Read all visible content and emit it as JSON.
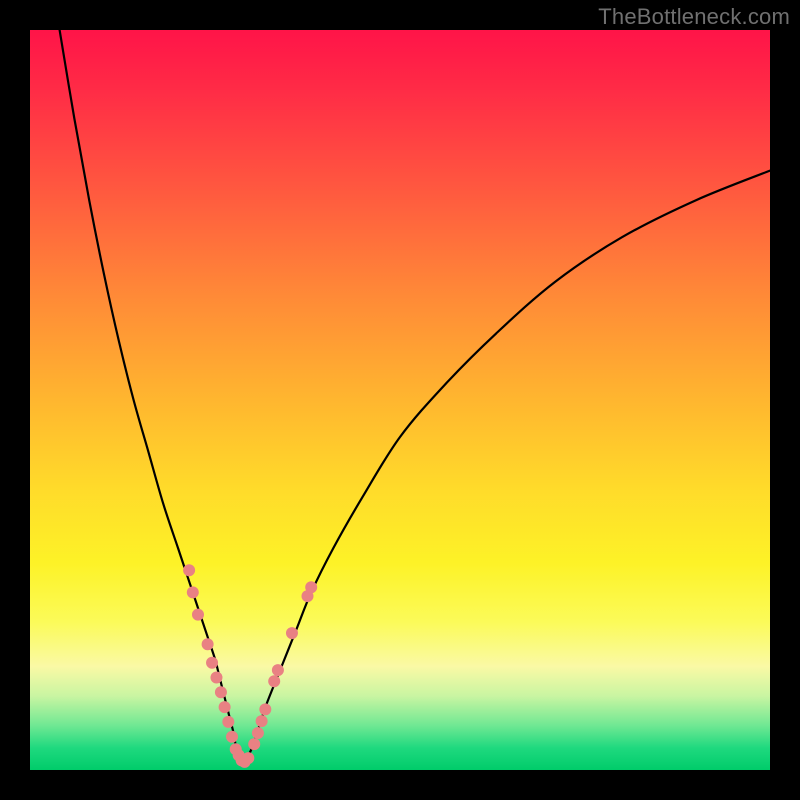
{
  "watermark": "TheBottleneck.com",
  "colors": {
    "frame": "#000000",
    "curve": "#000000",
    "marker_fill": "#e98183",
    "marker_stroke": "#e98183",
    "gradient_stops": [
      "#ff1448",
      "#ff5a3f",
      "#ffb62f",
      "#fdf227",
      "#00cc6a"
    ]
  },
  "chart_data": {
    "type": "line",
    "title": "",
    "xlabel": "",
    "ylabel": "",
    "xlim": [
      0,
      100
    ],
    "ylim": [
      0,
      100
    ],
    "grid": false,
    "legend": false,
    "annotations": [
      {
        "text": "TheBottleneck.com",
        "position": "top-right"
      }
    ],
    "series": [
      {
        "name": "left-branch",
        "x": [
          4,
          6,
          8,
          10,
          12,
          14,
          16,
          18,
          20,
          21,
          22,
          23,
          24,
          25,
          25.5,
          26,
          26.5,
          27,
          27.5,
          28
        ],
        "y": [
          100,
          88,
          77,
          67,
          58,
          50,
          43,
          36,
          30,
          27,
          24,
          21,
          18,
          15,
          13,
          11,
          9,
          7,
          5,
          2
        ]
      },
      {
        "name": "right-branch",
        "x": [
          29,
          30,
          31,
          32,
          34,
          36,
          38,
          41,
          45,
          50,
          56,
          63,
          71,
          80,
          90,
          100
        ],
        "y": [
          1,
          3,
          6,
          9,
          14,
          19,
          24,
          30,
          37,
          45,
          52,
          59,
          66,
          72,
          77,
          81
        ]
      }
    ],
    "markers": [
      {
        "x": 21.5,
        "y": 27
      },
      {
        "x": 22.0,
        "y": 24
      },
      {
        "x": 22.7,
        "y": 21
      },
      {
        "x": 24.0,
        "y": 17
      },
      {
        "x": 24.6,
        "y": 14.5
      },
      {
        "x": 25.2,
        "y": 12.5
      },
      {
        "x": 25.8,
        "y": 10.5
      },
      {
        "x": 26.3,
        "y": 8.5
      },
      {
        "x": 26.8,
        "y": 6.5
      },
      {
        "x": 27.3,
        "y": 4.5
      },
      {
        "x": 27.8,
        "y": 2.8
      },
      {
        "x": 28.2,
        "y": 2.0
      },
      {
        "x": 28.6,
        "y": 1.3
      },
      {
        "x": 29.0,
        "y": 1.1
      },
      {
        "x": 29.5,
        "y": 1.6
      },
      {
        "x": 30.3,
        "y": 3.5
      },
      {
        "x": 30.8,
        "y": 5.0
      },
      {
        "x": 31.3,
        "y": 6.6
      },
      {
        "x": 31.8,
        "y": 8.2
      },
      {
        "x": 33.0,
        "y": 12.0
      },
      {
        "x": 33.5,
        "y": 13.5
      },
      {
        "x": 35.4,
        "y": 18.5
      },
      {
        "x": 37.5,
        "y": 23.5
      },
      {
        "x": 38.0,
        "y": 24.7
      }
    ],
    "marker_radius_px": 6
  }
}
